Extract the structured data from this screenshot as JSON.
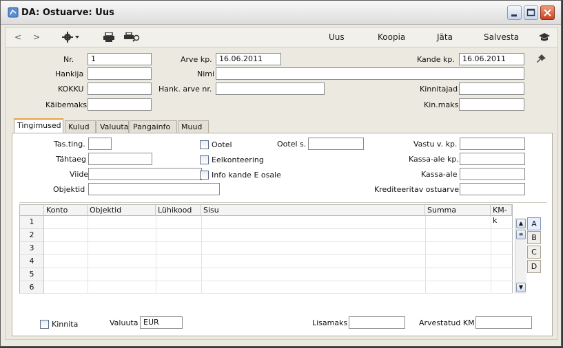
{
  "window": {
    "title": "DA: Ostuarve: Uus"
  },
  "toolbar": {
    "back": "<",
    "forward": ">",
    "uus": "Uus",
    "koopia": "Koopia",
    "jata": "Jäta",
    "salvesta": "Salvesta"
  },
  "header": {
    "nr_label": "Nr.",
    "nr_value": "1",
    "arve_kp_label": "Arve kp.",
    "arve_kp_value": "16.06.2011",
    "kande_kp_label": "Kande kp.",
    "kande_kp_value": "16.06.2011",
    "hankija_label": "Hankija",
    "hankija_value": "",
    "nimi_label": "Nimi",
    "nimi_value": "",
    "kokku_label": "KOKKU",
    "kokku_value": "",
    "hank_arve_nr_label": "Hank. arve nr.",
    "hank_arve_nr_value": "",
    "kinnitajad_label": "Kinnitajad",
    "kinnitajad_value": "",
    "kaibemaks_label": "Käibemaks",
    "kaibemaks_value": "",
    "kin_maks_label": "Kin.maks",
    "kin_maks_value": ""
  },
  "tabs": [
    "Tingimused",
    "Kulud",
    "Valuuta",
    "Pangainfo",
    "Muud"
  ],
  "conditions": {
    "tas_ting_label": "Tas.ting.",
    "tahtaeg_label": "Tähtaeg",
    "viide_label": "Viide",
    "objektid_label": "Objektid",
    "ootel_label": "Ootel",
    "eelkonteering_label": "Eelkonteering",
    "info_label": "Info kande E osale",
    "ootel_s_label": "Ootel s.",
    "vastu_label": "Vastu v. kp.",
    "kassa_ale_kp_label": "Kassa-ale kp.",
    "kassa_ale_label": "Kassa-ale",
    "krediteeritav_label": "Krediteeritav ostuarve"
  },
  "grid": {
    "columns": [
      "Konto",
      "Objektid",
      "Lühikood",
      "Sisu",
      "Summa",
      "KM-k"
    ],
    "rows": [
      "1",
      "2",
      "3",
      "4",
      "5",
      "6"
    ],
    "side_tabs": [
      "A",
      "B",
      "C",
      "D"
    ]
  },
  "footer": {
    "kinnita_label": "Kinnita",
    "valuuta_label": "Valuuta",
    "valuuta_value": "EUR",
    "lisamaks_label": "Lisamaks",
    "lisamaks_value": "",
    "arvestatud_km_label": "Arvestatud KM",
    "arvestatud_km_value": ""
  },
  "colors": {
    "title_bg": "#e6e6e6",
    "accent_tab": "#e8a33c",
    "close_button": "#c9421c"
  }
}
